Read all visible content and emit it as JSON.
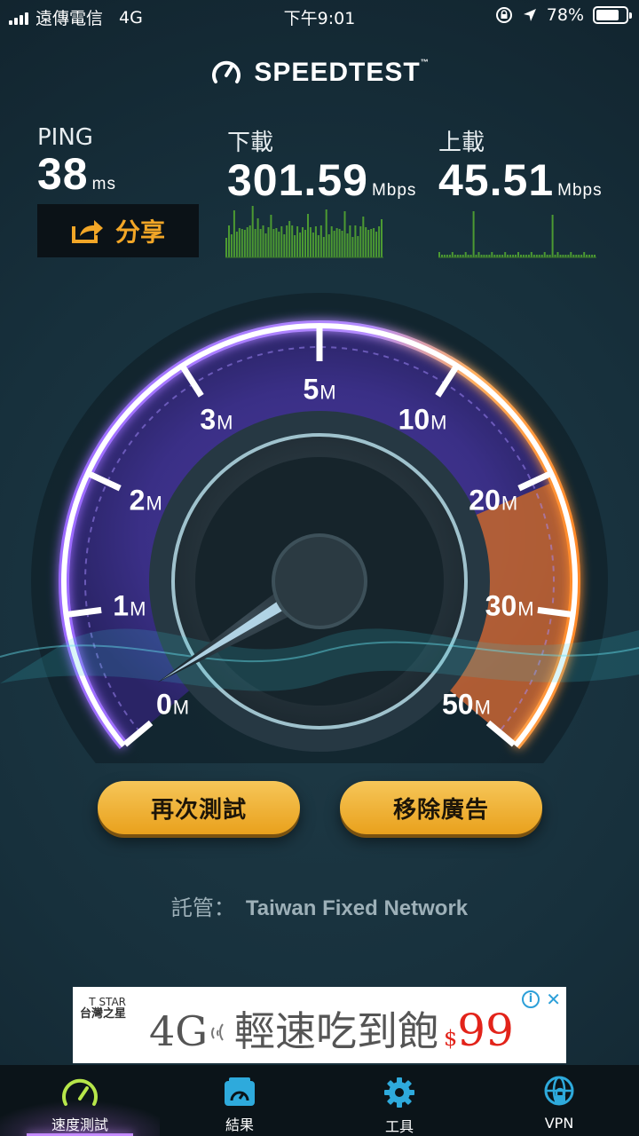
{
  "status_bar": {
    "carrier": "遠傳電信",
    "network": "4G",
    "time": "下午9:01",
    "battery": "78%",
    "battery_level": 0.78,
    "icons": [
      "signal-icon",
      "rotation-lock-icon",
      "location-icon",
      "battery-icon"
    ]
  },
  "app": {
    "title": "SPEEDTEST",
    "trademark": "™",
    "logo_icon": "speedometer-icon"
  },
  "ping": {
    "label": "PING",
    "value": "38",
    "unit": "ms"
  },
  "download": {
    "label": "下載",
    "value": "301.59",
    "unit": "Mbps"
  },
  "upload": {
    "label": "上載",
    "value": "45.51",
    "unit": "Mbps"
  },
  "share": {
    "label": "分享",
    "icon": "share-icon",
    "color": "#f2a627"
  },
  "gauge": {
    "ticks": [
      {
        "num": "0",
        "unit": "M"
      },
      {
        "num": "1",
        "unit": "M"
      },
      {
        "num": "2",
        "unit": "M"
      },
      {
        "num": "3",
        "unit": "M"
      },
      {
        "num": "5",
        "unit": "M"
      },
      {
        "num": "10",
        "unit": "M"
      },
      {
        "num": "20",
        "unit": "M"
      },
      {
        "num": "30",
        "unit": "M"
      },
      {
        "num": "50",
        "unit": "M"
      }
    ],
    "colors": {
      "arc_start": "#8a4dff",
      "arc_end": "#ff8a2a",
      "needle": "#bfe9ff"
    }
  },
  "buttons": {
    "retest": "再次測試",
    "remove_ads": "移除廣告"
  },
  "host": {
    "label": "託管：",
    "name": "Taiwan Fixed Network"
  },
  "ad": {
    "brand_top": "T STAR",
    "brand_name": "台灣之星",
    "network": "4G",
    "text": "輕速吃到飽",
    "currency": "$",
    "price": "99",
    "info": "i",
    "close": "✕"
  },
  "tabs": [
    {
      "label": "速度測試",
      "icon": "speedometer-icon",
      "active": true
    },
    {
      "label": "結果",
      "icon": "results-icon",
      "active": false
    },
    {
      "label": "工具",
      "icon": "gear-icon",
      "active": false
    },
    {
      "label": "VPN",
      "icon": "vpn-globe-icon",
      "active": false
    }
  ]
}
